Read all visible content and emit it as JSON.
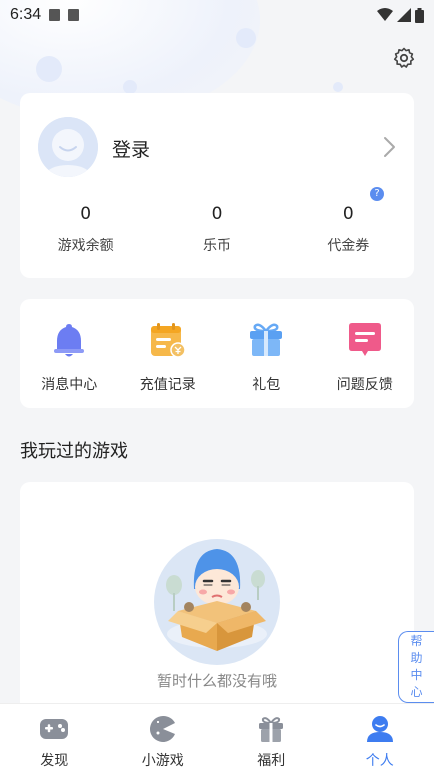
{
  "status_bar": {
    "time": "6:34"
  },
  "profile": {
    "login_label": "登录",
    "stats": [
      {
        "value": "0",
        "label": "游戏余额"
      },
      {
        "value": "0",
        "label": "乐币"
      },
      {
        "value": "0",
        "label": "代金券"
      }
    ],
    "help_badge": "?"
  },
  "menu": {
    "items": [
      {
        "label": "消息中心",
        "icon": "bell-icon"
      },
      {
        "label": "充值记录",
        "icon": "recharge-record-icon"
      },
      {
        "label": "礼包",
        "icon": "gift-icon"
      },
      {
        "label": "问题反馈",
        "icon": "feedback-icon"
      }
    ]
  },
  "games_section": {
    "title": "我玩过的游戏",
    "empty_text": "暂时什么都没有哦"
  },
  "help_tab": {
    "chars": [
      "帮",
      "助",
      "中",
      "心"
    ]
  },
  "bottom_nav": {
    "items": [
      {
        "label": "发现",
        "icon": "gamepad-icon",
        "active": false
      },
      {
        "label": "小游戏",
        "icon": "mini-game-icon",
        "active": false
      },
      {
        "label": "福利",
        "icon": "gift-icon",
        "active": false
      },
      {
        "label": "个人",
        "icon": "person-icon",
        "active": true
      }
    ]
  },
  "colors": {
    "accent": "#3d7cf0",
    "background": "#f4f5f7"
  }
}
